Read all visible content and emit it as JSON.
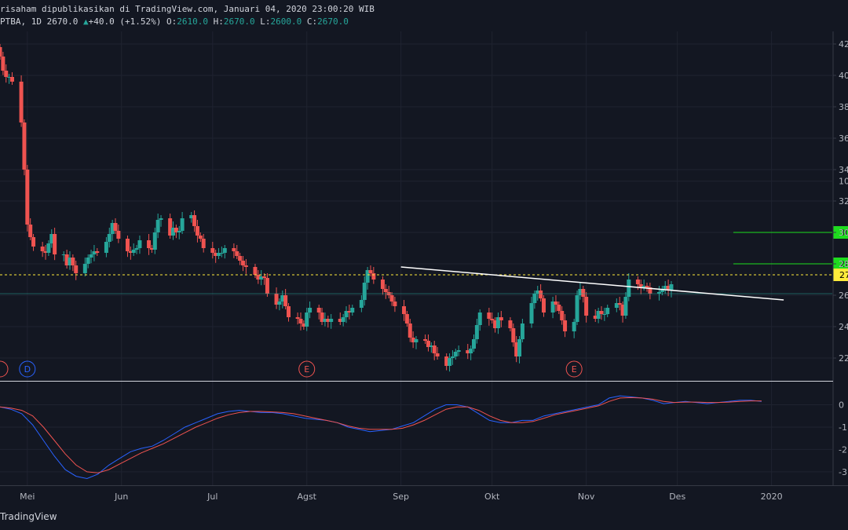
{
  "header": {
    "publish_line": "risaham dipublikasikan di TradingView.com, Januari 04, 2020 23:00:20 WIB",
    "symbol_tf": "PTBA, 1D",
    "last": "2670.0",
    "change_arrow": "▲",
    "change": "+40.0 (+1.52%)",
    "o_label": "O:",
    "o": "2610.0",
    "h_label": "H:",
    "h": "2670.0",
    "l_label": "L:",
    "l": "2600.0",
    "c_label": "C:",
    "c": "2670.0"
  },
  "footer": {
    "brand": "TradingView"
  },
  "colors": {
    "background": "#131722",
    "grid": "#1f2330",
    "up": "#26a69a",
    "down": "#ef5350",
    "trendline": "#ffffff",
    "level_line": "#ffeb3b",
    "target_line": "#1edd1e",
    "macd": "#2962ff",
    "signal": "#ef5350",
    "axis_text": "#b2b5be"
  },
  "chart_data": [
    {
      "type": "candlestick",
      "symbol": "PTBA",
      "interval": "1D",
      "y_tick_labels": [
        "42",
        "40",
        "38",
        "36",
        "34",
        "32",
        "30",
        "28",
        "26",
        "24",
        "22"
      ],
      "ylim": [
        2060,
        4280
      ],
      "x_tick_labels": [
        "Mei",
        "Jun",
        "Jul",
        "Agst",
        "Sep",
        "Okt",
        "Nov",
        "Des",
        "2020"
      ],
      "x_ticks": [
        "2019-05-01",
        "2019-06-01",
        "2019-07-01",
        "2019-08-01",
        "2019-09-01",
        "2019-10-01",
        "2019-11-01",
        "2019-12-01",
        "2020-01-01"
      ],
      "xlim": [
        "2019-04-22",
        "2020-01-21"
      ],
      "candles_close": [
        4120,
        4030,
        3990,
        3990,
        3960,
        3700,
        3400,
        3050,
        2970,
        2910,
        2880,
        2870,
        2930,
        2990,
        2860,
        2860,
        2790,
        2840,
        2790,
        2740,
        2800,
        2840,
        2860,
        2880,
        2870,
        2940,
        2990,
        3060,
        3010,
        2960,
        2880,
        2870,
        2890,
        2900,
        2950,
        2900,
        2890,
        3000,
        3080,
        3090,
        2980,
        3030,
        3000,
        3010,
        3090,
        3110,
        3040,
        2980,
        2960,
        2900,
        2870,
        2850,
        2870,
        2870,
        2900,
        2880,
        2850,
        2820,
        2790,
        2780,
        2730,
        2700,
        2720,
        2710,
        2610,
        2540,
        2560,
        2600,
        2530,
        2460,
        2450,
        2420,
        2400,
        2490,
        2520,
        2490,
        2430,
        2450,
        2430,
        2450,
        2430,
        2460,
        2500,
        2490,
        2520,
        2570,
        2680,
        2760,
        2740,
        2700,
        2640,
        2620,
        2600,
        2560,
        2530,
        2480,
        2420,
        2330,
        2300,
        2320,
        2310,
        2270,
        2280,
        2230,
        2210,
        2150,
        2200,
        2210,
        2240,
        2250,
        2230,
        2260,
        2320,
        2410,
        2490,
        2450,
        2440,
        2390,
        2460,
        2440,
        2390,
        2300,
        2210,
        2320,
        2420,
        2550,
        2610,
        2630,
        2580,
        2490,
        2560,
        2540,
        2500,
        2440,
        2370,
        2430,
        2600,
        2640,
        2590,
        2470,
        2450,
        2500,
        2480,
        2480,
        2520,
        2550,
        2540,
        2470,
        2590,
        2700,
        2670,
        2650,
        2660,
        2650,
        2610,
        2620,
        2640,
        2660,
        2630,
        2670
      ],
      "volume": null,
      "horizontal_levels": [
        {
          "value": 3000,
          "label": "30",
          "color": "target"
        },
        {
          "value": 2800,
          "label": "28",
          "color": "target"
        },
        {
          "value": 2730,
          "label": "27",
          "color": "level"
        }
      ],
      "trendline": {
        "start": [
          "2019-09-01",
          2780
        ],
        "end": [
          "2020-01-05",
          2570
        ]
      },
      "event_markers": [
        {
          "date": "2019-04-22",
          "label": ""
        },
        {
          "date": "2019-05-01",
          "label": "D"
        },
        {
          "date": "2019-08-01",
          "label": "E"
        },
        {
          "date": "2019-10-28",
          "label": "E"
        }
      ]
    },
    {
      "type": "line",
      "title": "",
      "y_tick_labels": [
        "10",
        "0",
        "-1",
        "-2",
        "-3"
      ],
      "ylim": [
        -360,
        100
      ],
      "series": [
        {
          "color": "macd",
          "values": [
            -10,
            -20,
            -40,
            -90,
            -160,
            -230,
            -290,
            -320,
            -330,
            -310,
            -270,
            -240,
            -210,
            -195,
            -185,
            -160,
            -130,
            -100,
            -80,
            -60,
            -40,
            -30,
            -25,
            -30,
            -35,
            -35,
            -40,
            -50,
            -60,
            -65,
            -70,
            -80,
            -100,
            -110,
            -120,
            -115,
            -110,
            -95,
            -80,
            -50,
            -20,
            0,
            0,
            -10,
            -40,
            -70,
            -80,
            -80,
            -70,
            -70,
            -50,
            -40,
            -30,
            -20,
            -10,
            0,
            30,
            40,
            35,
            30,
            20,
            5,
            10,
            15,
            10,
            5,
            10,
            15,
            20,
            20,
            15
          ]
        },
        {
          "color": "signal",
          "values": [
            -10,
            -15,
            -25,
            -50,
            -100,
            -160,
            -220,
            -270,
            -300,
            -305,
            -290,
            -265,
            -240,
            -215,
            -195,
            -175,
            -150,
            -125,
            -100,
            -80,
            -60,
            -45,
            -35,
            -30,
            -30,
            -32,
            -35,
            -40,
            -50,
            -60,
            -70,
            -80,
            -95,
            -105,
            -110,
            -110,
            -110,
            -105,
            -90,
            -70,
            -45,
            -20,
            -10,
            -10,
            -25,
            -50,
            -70,
            -80,
            -80,
            -75,
            -60,
            -45,
            -35,
            -25,
            -15,
            -5,
            15,
            30,
            32,
            30,
            25,
            15,
            10,
            12,
            12,
            10,
            10,
            12,
            15,
            17,
            17
          ]
        }
      ]
    }
  ]
}
